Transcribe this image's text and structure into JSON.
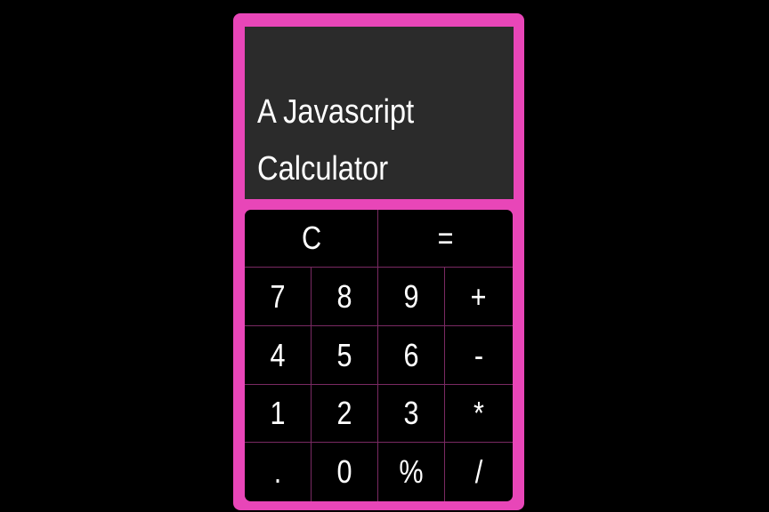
{
  "display": {
    "lines": [
      "A Javascript",
      "Calculator"
    ]
  },
  "keypad": {
    "row1": [
      "C",
      "="
    ],
    "row2": [
      "7",
      "8",
      "9",
      "+"
    ],
    "row3": [
      "4",
      "5",
      "6",
      "-"
    ],
    "row4": [
      "1",
      "2",
      "3",
      "*"
    ],
    "row5": [
      ".",
      "0",
      "%",
      "/"
    ]
  },
  "colors": {
    "frame": "#e846b8",
    "display_bg": "#2b2b2b",
    "keypad_bg": "#000000",
    "grid_line": "#7a2a63",
    "text": "#ffffff"
  }
}
